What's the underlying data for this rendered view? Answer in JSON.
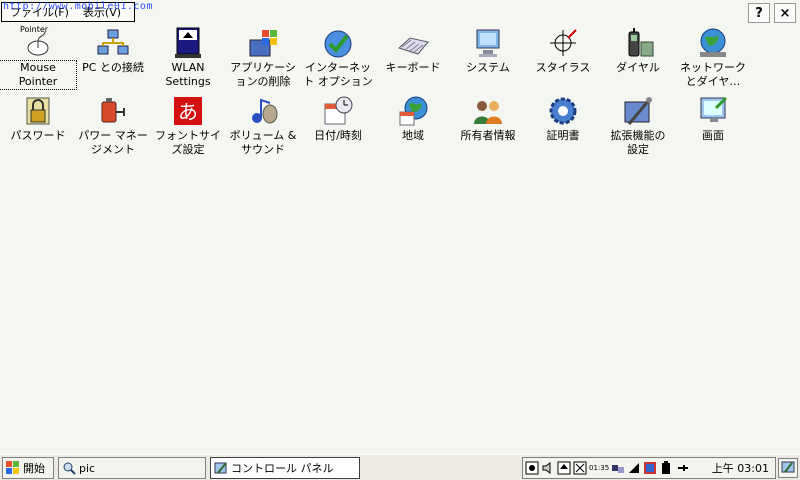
{
  "watermark": "http://www.mobile01.com",
  "menubar": {
    "file": "ファイル(F)",
    "view": "表示(V)"
  },
  "topbar": {
    "help": "?",
    "close": "×"
  },
  "items": [
    {
      "label": "Mouse\nPointer",
      "caption": "Pointer",
      "icon": "mouse-pointer-icon"
    },
    {
      "label": "PC との接続",
      "icon": "pc-connection-icon"
    },
    {
      "label": "WLAN\nSettings",
      "icon": "wlan-settings-icon"
    },
    {
      "label": "アプリケーシ\nョンの削除",
      "icon": "remove-programs-icon"
    },
    {
      "label": "インターネッ\nト オプション",
      "icon": "internet-options-icon"
    },
    {
      "label": "キーボード",
      "icon": "keyboard-icon"
    },
    {
      "label": "システム",
      "icon": "system-icon"
    },
    {
      "label": "スタイラス",
      "icon": "stylus-icon"
    },
    {
      "label": "ダイヤル",
      "icon": "dialing-icon"
    },
    {
      "label": "ネットワーク\nとダイヤ…",
      "icon": "network-dialup-icon"
    },
    {
      "label": "パスワード",
      "icon": "password-icon"
    },
    {
      "label": "パワー マネー\nジメント",
      "icon": "power-management-icon"
    },
    {
      "label": "フォントサイ\nズ設定",
      "icon": "font-size-icon"
    },
    {
      "label": "ボリューム &\nサウンド",
      "icon": "volume-sound-icon"
    },
    {
      "label": "日付/時刻",
      "icon": "date-time-icon"
    },
    {
      "label": "地域",
      "icon": "regional-icon"
    },
    {
      "label": "所有者情報",
      "icon": "owner-info-icon"
    },
    {
      "label": "証明書",
      "icon": "certificates-icon"
    },
    {
      "label": "拡張機能の\n設定",
      "icon": "extensions-icon"
    },
    {
      "label": "画面",
      "icon": "display-icon"
    }
  ],
  "taskbar": {
    "start": "開始",
    "app": "pic",
    "active": "コントロール パネル",
    "clock": "上午 03:01",
    "tray_time": "01:35"
  }
}
